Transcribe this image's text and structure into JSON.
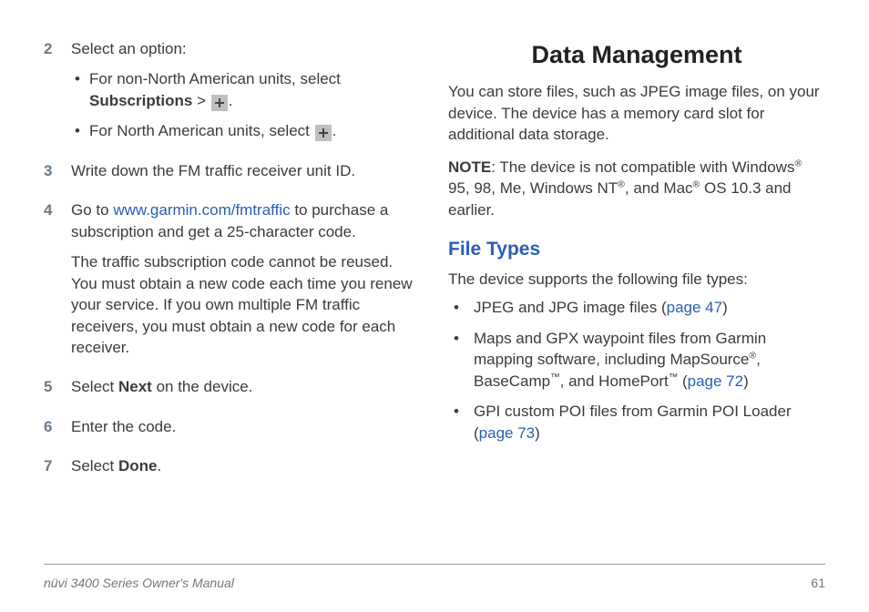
{
  "left": {
    "steps": {
      "n2": "2",
      "s2_intro": "Select an option:",
      "s2_b1_pre": "For non-North American units, select ",
      "s2_b1_bold": "Subscriptions",
      "s2_b1_gt": " > ",
      "s2_b1_post": ".",
      "s2_b2_pre": "For North American units, select ",
      "s2_b2_post": ".",
      "n3": "3",
      "s3": "Write down the FM traffic receiver unit ID.",
      "n4": "4",
      "s4_pre": "Go to ",
      "s4_link": "www.garmin.com/fmtraffic",
      "s4_post": " to purchase a subscription and get a 25-character code.",
      "s4_p2": "The traffic subscription code cannot be reused. You must obtain a new code each time you renew your service. If you own multiple FM traffic receivers, you must obtain a new code for each receiver.",
      "n5": "5",
      "s5_pre": "Select ",
      "s5_bold": "Next",
      "s5_post": " on the device.",
      "n6": "6",
      "s6": "Enter the code.",
      "n7": "7",
      "s7_pre": "Select ",
      "s7_bold": "Done",
      "s7_post": "."
    }
  },
  "right": {
    "h1": "Data Management",
    "intro": "You can store files, such as JPEG image files, on your device. The device has a memory card slot for additional data storage.",
    "note_label": "NOTE",
    "note_pre": ": The device is not compatible with Windows",
    "note_mid1": " 95, 98, Me, Windows NT",
    "note_mid2": ", and Mac",
    "note_post": " OS 10.3 and earlier.",
    "reg": "®",
    "h2": "File Types",
    "ft_intro": "The device supports the following file types:",
    "b1_pre": "JPEG and JPG image files (",
    "b1_link": "page 47",
    "b1_post": ")",
    "b2_pre": "Maps and GPX waypoint files from Garmin mapping software, including MapSource",
    "b2_mid1": ", BaseCamp",
    "b2_mid2": ", and HomePort",
    "b2_post_open": " (",
    "b2_link": "page 72",
    "b2_post_close": ")",
    "tm": "™",
    "b3_pre": "GPI custom POI files from Garmin POI Loader (",
    "b3_link": "page 73",
    "b3_post": ")"
  },
  "footer": {
    "title": "nüvi 3400 Series Owner's Manual",
    "page": "61"
  }
}
